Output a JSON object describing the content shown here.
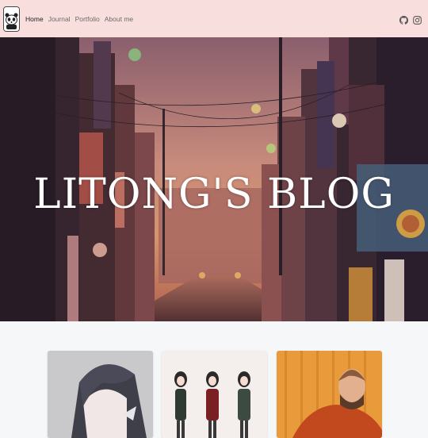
{
  "nav": {
    "logo_icon": "panda-logo-icon",
    "links": [
      {
        "label": "Home"
      },
      {
        "label": "Journal"
      },
      {
        "label": "Portfolio"
      },
      {
        "label": "About me"
      }
    ],
    "icons": [
      "github-icon",
      "instagram-icon"
    ]
  },
  "hero": {
    "title": "LITONG'S BLOG"
  },
  "colors": {
    "nav_bg": "#f9dede",
    "page_bg": "#f6f7f9",
    "hero_title": "#ffffff"
  }
}
